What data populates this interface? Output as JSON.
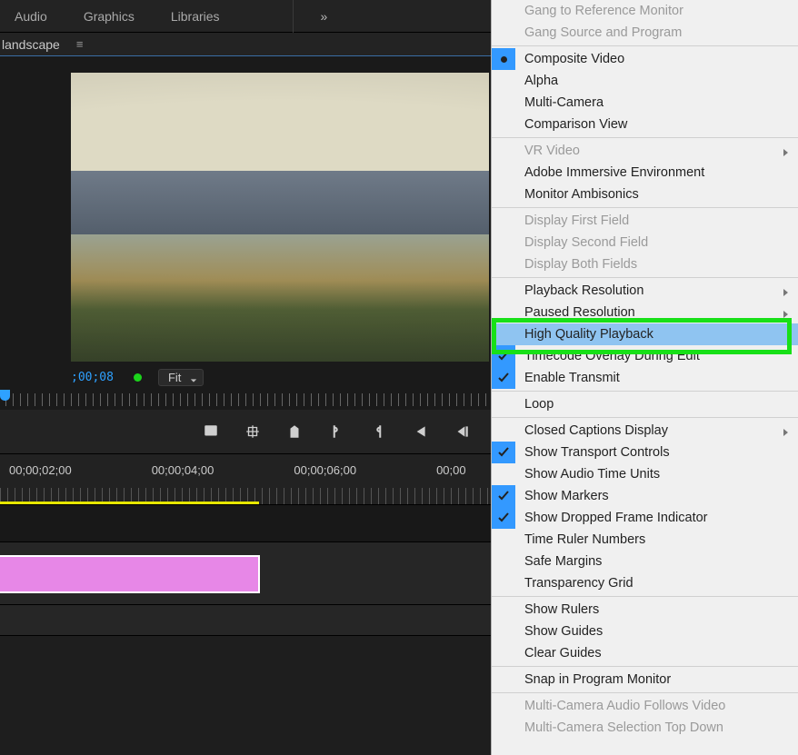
{
  "topmenu": {
    "audio": "Audio",
    "graphics": "Graphics",
    "libraries": "Libraries",
    "more": "»"
  },
  "panel": {
    "title": "landscape"
  },
  "monitor": {
    "timecode": ";00;08",
    "fit_label": "Fit"
  },
  "timeline": {
    "t0": "00;00;02;00",
    "t1": "00;00;04;00",
    "t2": "00;00;06;00",
    "t3": "00;00"
  },
  "menu": {
    "gang_ref": "Gang to Reference Monitor",
    "gang_src": "Gang Source and Program",
    "composite": "Composite Video",
    "alpha": "Alpha",
    "multicam": "Multi-Camera",
    "compare": "Comparison View",
    "vr": "VR Video",
    "adobe_imm": "Adobe Immersive Environment",
    "monitor_amb": "Monitor Ambisonics",
    "disp_first": "Display First Field",
    "disp_second": "Display Second Field",
    "disp_both": "Display Both Fields",
    "playback_res": "Playback Resolution",
    "paused_res": "Paused Resolution",
    "hq_playback": "High Quality Playback",
    "tc_overlay": "Timecode Overlay During Edit",
    "enable_tx": "Enable Transmit",
    "loop": "Loop",
    "cc_display": "Closed Captions Display",
    "show_transport": "Show Transport Controls",
    "show_audio_units": "Show Audio Time Units",
    "show_markers": "Show Markers",
    "show_dropped": "Show Dropped Frame Indicator",
    "time_ruler_no": "Time Ruler Numbers",
    "safe_margins": "Safe Margins",
    "transparency": "Transparency Grid",
    "show_rulers": "Show Rulers",
    "show_guides": "Show Guides",
    "clear_guides": "Clear Guides",
    "snap": "Snap in Program Monitor",
    "mc_audio": "Multi-Camera Audio Follows Video",
    "mc_sel": "Multi-Camera Selection Top Down"
  }
}
